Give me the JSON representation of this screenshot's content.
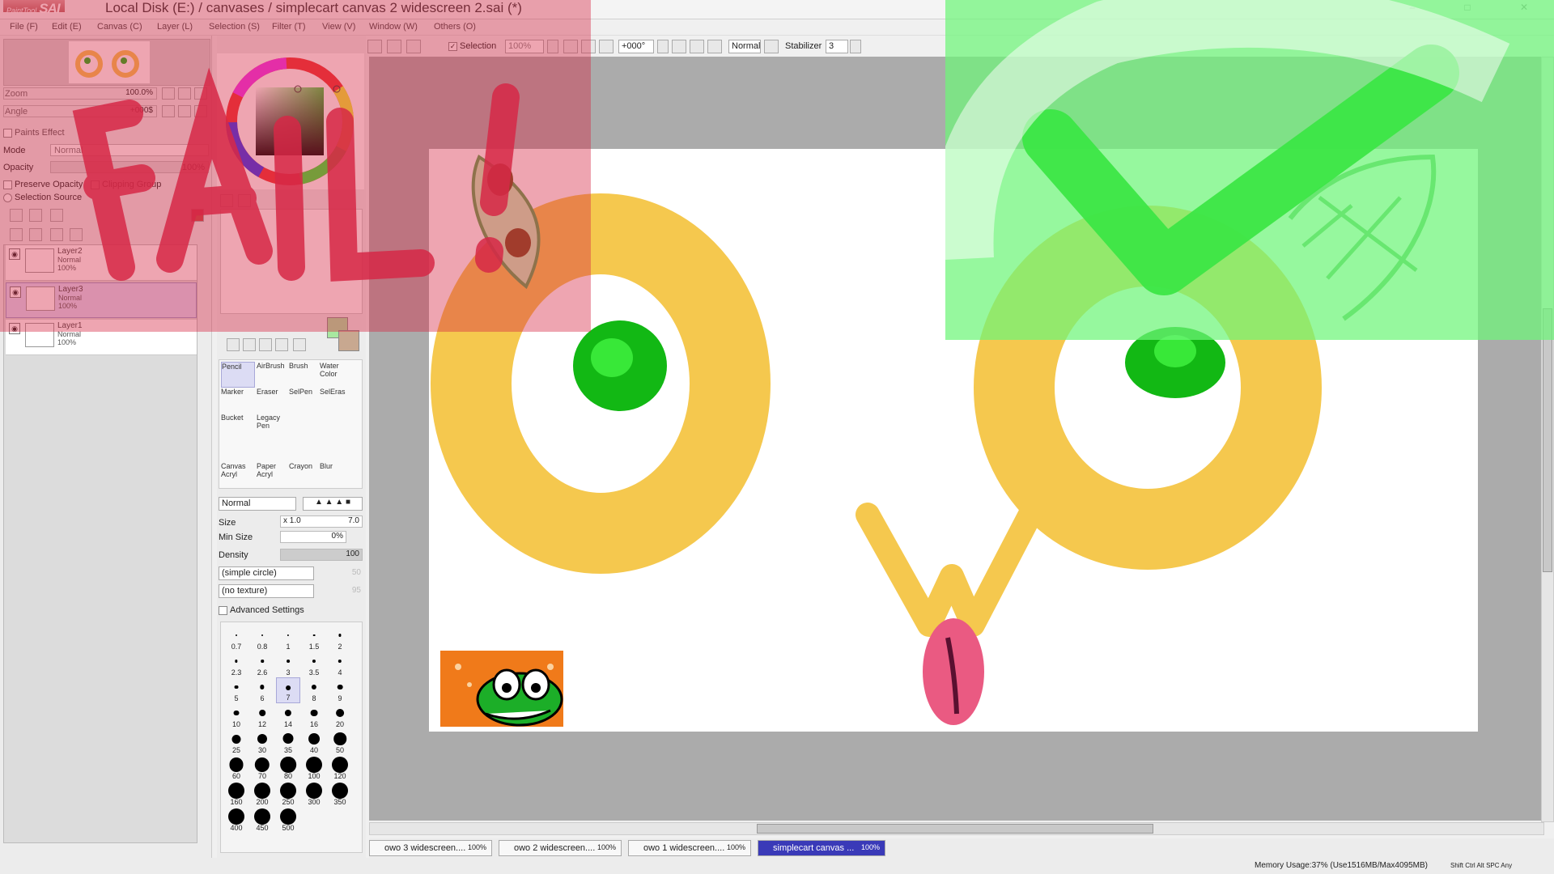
{
  "window": {
    "app_logo_small": "PaintTool",
    "app_logo_big": "SAI",
    "title": "Local Disk (E:) / canvases / simplecart canvas 2 widescreen 2.sai (*)"
  },
  "menu": [
    "File (F)",
    "Edit (E)",
    "Canvas (C)",
    "Layer (L)",
    "Selection (S)",
    "Filter (T)",
    "View (V)",
    "Window (W)",
    "Others (O)"
  ],
  "toolbar": {
    "selection_label": "Selection",
    "selection_checked": true,
    "zoom_value": "100%",
    "angle_value": "+000°",
    "blend_value": "Normal",
    "stabilizer_label": "Stabilizer",
    "stabilizer_value": "3"
  },
  "navigator": {
    "zoom_label": "Zoom",
    "zoom_value": "100.0%",
    "angle_label": "Angle",
    "angle_value": "+000$"
  },
  "paints_effect": {
    "header": "Paints Effect",
    "mode_label": "Mode",
    "mode_value": "Normal",
    "opacity_label": "Opacity",
    "opacity_value": "100%",
    "preserve_opacity": "Preserve Opacity",
    "clipping_group": "Clipping Group",
    "selection_source": "Selection Source"
  },
  "layers": [
    {
      "name": "Layer2",
      "mode": "Normal",
      "opacity": "100%"
    },
    {
      "name": "Layer3",
      "mode": "Normal",
      "opacity": "100%"
    },
    {
      "name": "Layer1",
      "mode": "Normal",
      "opacity": "100%"
    }
  ],
  "tools": [
    {
      "label": "Pencil",
      "selected": true
    },
    {
      "label": "AirBrush",
      "selected": false
    },
    {
      "label": "Brush",
      "selected": false
    },
    {
      "label": "Water Color",
      "selected": false
    },
    {
      "label": "Marker",
      "selected": false
    },
    {
      "label": "Eraser",
      "selected": false
    },
    {
      "label": "SelPen",
      "selected": false
    },
    {
      "label": "SelEras",
      "selected": false
    },
    {
      "label": "Bucket",
      "selected": false
    },
    {
      "label": "Legacy Pen",
      "selected": false
    },
    {
      "label": "Canvas Acryl",
      "selected": false
    },
    {
      "label": "Paper Acryl",
      "selected": false
    },
    {
      "label": "Crayon",
      "selected": false
    },
    {
      "label": "Blur",
      "selected": false
    }
  ],
  "brush": {
    "blend_mode": "Normal",
    "size_label": "Size",
    "size_mult": "x 1.0",
    "size_value": "7.0",
    "minsize_label": "Min Size",
    "minsize_value": "0%",
    "density_label": "Density",
    "density_value": "100",
    "shape_value": "(simple circle)",
    "shape_num": "50",
    "texture_value": "(no texture)",
    "texture_num": "95",
    "advanced": "Advanced Settings"
  },
  "brush_sizes": [
    "0.7",
    "0.8",
    "1",
    "1.5",
    "2",
    "2.3",
    "2.6",
    "3",
    "3.5",
    "4",
    "5",
    "6",
    "7",
    "8",
    "9",
    "10",
    "12",
    "14",
    "16",
    "20",
    "25",
    "30",
    "35",
    "40",
    "50",
    "60",
    "70",
    "80",
    "100",
    "120",
    "160",
    "200",
    "250",
    "300",
    "350",
    "400",
    "450",
    "500"
  ],
  "selected_brush_size": "7",
  "colors": {
    "primary": "#a8e8a0",
    "secondary": "#c8a890",
    "fail_overlay": "#d62846",
    "ok_overlay": "#6ef578",
    "eye_yellow": "#f5c84e",
    "pupil_green": "#12b814",
    "tongue_pink": "#ea5a82"
  },
  "doc_tabs": [
    {
      "label": "owo 3 widescreen....",
      "zoom": "100%",
      "active": false
    },
    {
      "label": "owo 2 widescreen....",
      "zoom": "100%",
      "active": false
    },
    {
      "label": "owo 1 widescreen....",
      "zoom": "100%",
      "active": false
    },
    {
      "label": "simplecart canvas ...",
      "zoom": "100%",
      "active": true
    }
  ],
  "status": {
    "memory": "Memory Usage:37% (Use1516MB/Max4095MB)",
    "keys": [
      "Shift",
      "Ctrl",
      "Alt",
      "SPC",
      "Any"
    ]
  }
}
